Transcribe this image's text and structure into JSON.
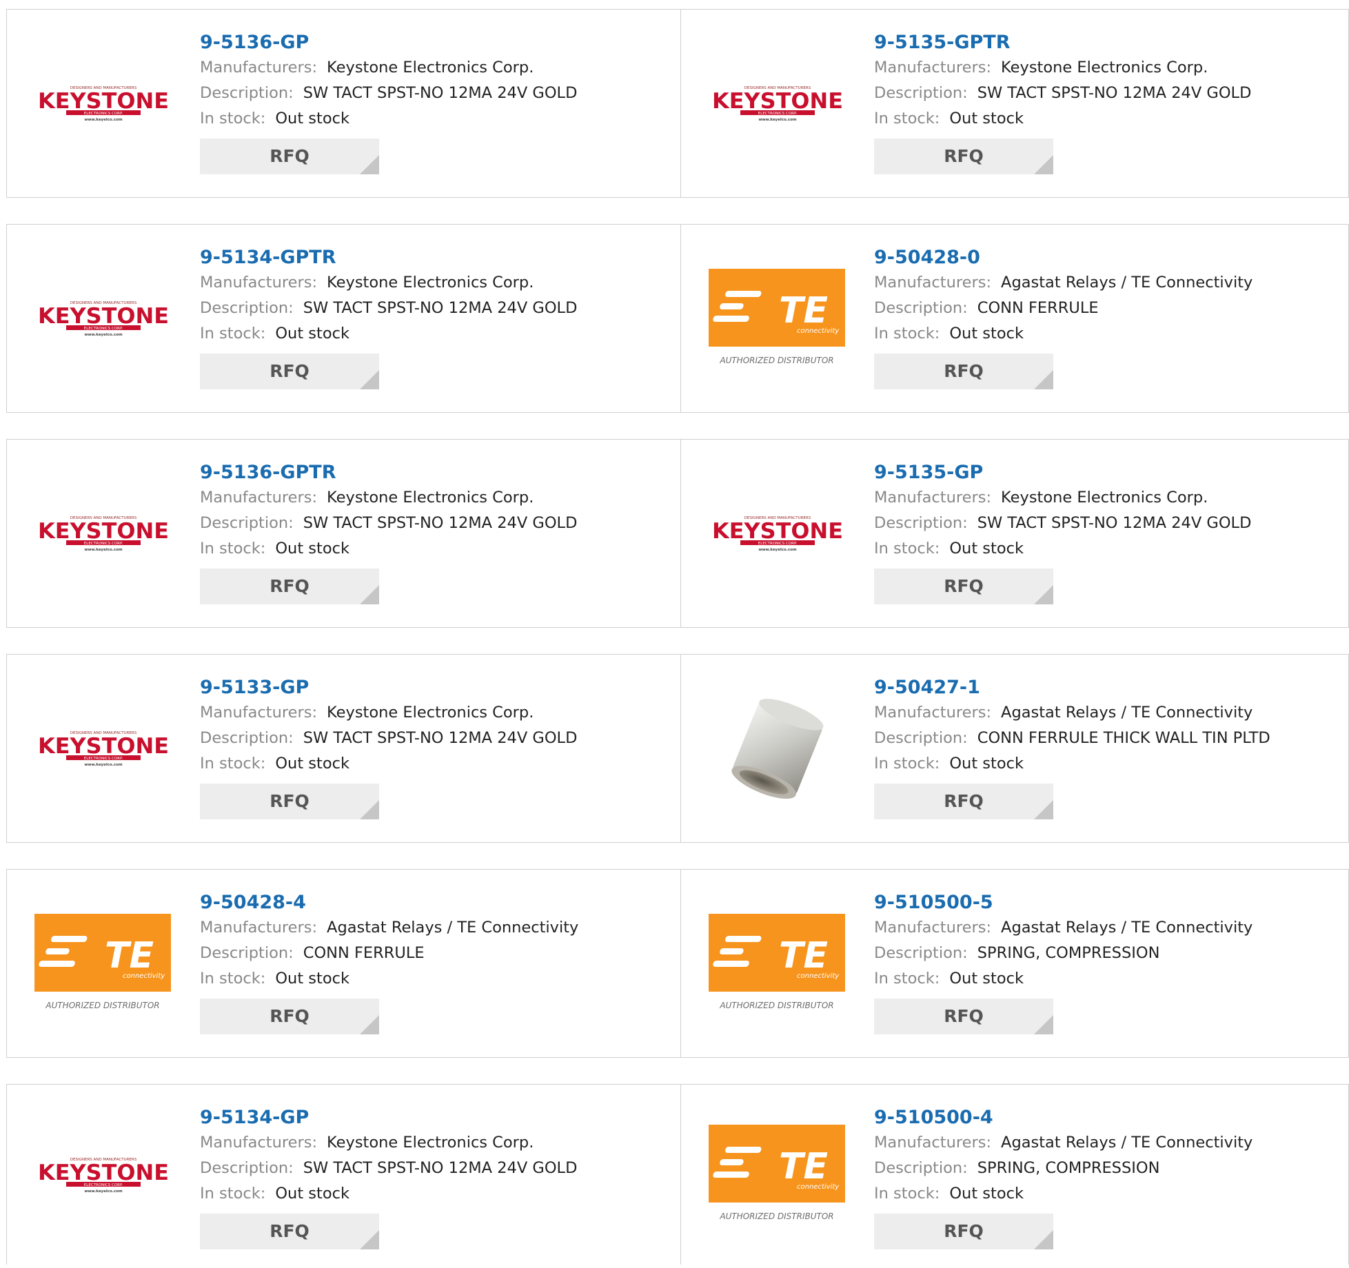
{
  "labels": {
    "manufacturers": "Manufacturers:",
    "description": "Description:",
    "in_stock": "In stock:",
    "rfq": "RFQ"
  },
  "brand": {
    "link_color": "#1a6cb0",
    "keystone_red": "#c8102e",
    "te_orange": "#f7941d",
    "keystone_wordmark": "KEYSTONE",
    "keystone_tagline": "DESIGNERS AND MANUFACTURERS",
    "keystone_sub": "ELECTRONICS CORP.",
    "keystone_url": "www.keyelco.com",
    "te_wordmark": "TE",
    "te_sub": "connectivity",
    "te_caption": "AUTHORIZED DISTRIBUTOR"
  },
  "products": [
    {
      "part": "9-5136-GP",
      "logo": "keystone-logo",
      "manufacturer": "Keystone Electronics Corp.",
      "description": "SW TACT SPST-NO 12MA 24V GOLD",
      "stock": "Out stock"
    },
    {
      "part": "9-5135-GPTR",
      "logo": "keystone-logo",
      "manufacturer": "Keystone Electronics Corp.",
      "description": "SW TACT SPST-NO 12MA 24V GOLD",
      "stock": "Out stock"
    },
    {
      "part": "9-5134-GPTR",
      "logo": "keystone-logo",
      "manufacturer": "Keystone Electronics Corp.",
      "description": "SW TACT SPST-NO 12MA 24V GOLD",
      "stock": "Out stock"
    },
    {
      "part": "9-50428-0",
      "logo": "te-logo",
      "manufacturer": "Agastat Relays / TE Connectivity",
      "description": "CONN FERRULE",
      "stock": "Out stock"
    },
    {
      "part": "9-5136-GPTR",
      "logo": "keystone-logo",
      "manufacturer": "Keystone Electronics Corp.",
      "description": "SW TACT SPST-NO 12MA 24V GOLD",
      "stock": "Out stock"
    },
    {
      "part": "9-5135-GP",
      "logo": "keystone-logo",
      "manufacturer": "Keystone Electronics Corp.",
      "description": "SW TACT SPST-NO 12MA 24V GOLD",
      "stock": "Out stock"
    },
    {
      "part": "9-5133-GP",
      "logo": "keystone-logo",
      "manufacturer": "Keystone Electronics Corp.",
      "description": "SW TACT SPST-NO 12MA 24V GOLD",
      "stock": "Out stock"
    },
    {
      "part": "9-50427-1",
      "logo": "ferrule-photo",
      "manufacturer": "Agastat Relays / TE Connectivity",
      "description": "CONN FERRULE THICK WALL TIN PLTD",
      "stock": "Out stock"
    },
    {
      "part": "9-50428-4",
      "logo": "te-logo",
      "manufacturer": "Agastat Relays / TE Connectivity",
      "description": "CONN FERRULE",
      "stock": "Out stock"
    },
    {
      "part": "9-510500-5",
      "logo": "te-logo",
      "manufacturer": "Agastat Relays / TE Connectivity",
      "description": "SPRING, COMPRESSION",
      "stock": "Out stock"
    },
    {
      "part": "9-5134-GP",
      "logo": "keystone-logo",
      "manufacturer": "Keystone Electronics Corp.",
      "description": "SW TACT SPST-NO 12MA 24V GOLD",
      "stock": "Out stock"
    },
    {
      "part": "9-510500-4",
      "logo": "te-logo",
      "manufacturer": "Agastat Relays / TE Connectivity",
      "description": "SPRING, COMPRESSION",
      "stock": "Out stock"
    }
  ]
}
